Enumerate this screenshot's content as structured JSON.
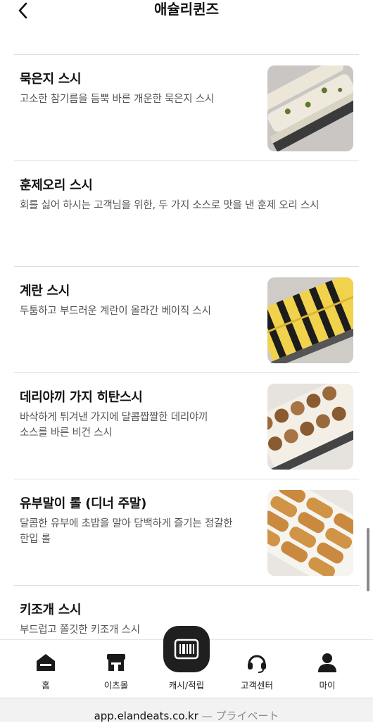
{
  "header": {
    "title": "애슐리퀸즈",
    "back_icon": "chevron-left-icon"
  },
  "menu_items": [
    {
      "name": "묵은지 스시",
      "desc": "고소한 참기름을 듬뿍 바른 개운한 묵은지 스시",
      "has_image": true
    },
    {
      "name": "훈제오리 스시",
      "desc": "회를 싫어 하시는 고객님을 위한, 두 가지 소스로 맛을 낸 훈제 오리 스시",
      "has_image": false
    },
    {
      "name": "계란 스시",
      "desc": "두툼하고 부드러운 계란이 올라간 베이직 스시",
      "has_image": true
    },
    {
      "name": "데리야끼 가지 히탄스시",
      "desc": "바삭하게 튀겨낸 가지에 달콤짭짤한 데리야끼\n소스를 바른 비건 스시",
      "has_image": true
    },
    {
      "name": "유부말이 롤 (디너 주말)",
      "desc": "달콤한 유부에 초밥을 말아 담백하게 즐기는 정갈한\n한입 롤",
      "has_image": true
    },
    {
      "name": "키조개 스시",
      "desc": "부드럽고 쫄깃한 키조개 스시",
      "has_image": false
    }
  ],
  "tabbar": {
    "tabs": [
      {
        "label": "홈",
        "icon": "home-icon"
      },
      {
        "label": "이츠몰",
        "icon": "store-icon"
      },
      {
        "label": "캐시/적립",
        "icon": "barcode-icon"
      },
      {
        "label": "고객센터",
        "icon": "headset-icon"
      },
      {
        "label": "마이",
        "icon": "person-icon"
      }
    ]
  },
  "browser": {
    "url": "app.elandeats.co.kr",
    "private_label": "— プライベート"
  },
  "colors": {
    "text": "#111111",
    "desc": "#555555",
    "divider": "#dedede",
    "center_button": "#1f1f1f"
  }
}
